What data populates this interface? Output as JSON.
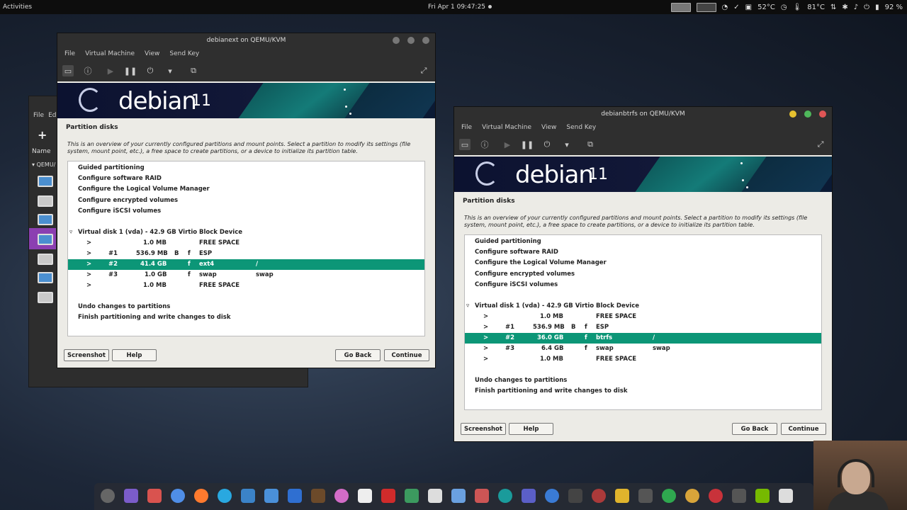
{
  "topbar": {
    "activities": "Activities",
    "clock": "Fri Apr 1  09:47:25",
    "temp1": "52°C",
    "temp2": "81°C",
    "battery": "92 %"
  },
  "background_window": {
    "menu": [
      "File",
      "Ed"
    ],
    "plus": "+",
    "name_header": "Name",
    "group": "QEMU/"
  },
  "vm_left": {
    "title": "debianext on QEMU/KVM",
    "menu": [
      "File",
      "Virtual Machine",
      "View",
      "Send Key"
    ],
    "banner": {
      "logo": "debian",
      "version": "11"
    },
    "page_title": "Partition disks",
    "description": "This is an overview of your currently configured partitions and mount points. Select a partition to modify its settings (file system, mount point, etc.), a free space to create partitions, or a device to initialize its partition table.",
    "options": [
      "Guided partitioning",
      "Configure software RAID",
      "Configure the Logical Volume Manager",
      "Configure encrypted volumes",
      "Configure iSCSI volumes"
    ],
    "disk": "Virtual disk 1 (vda) - 42.9 GB Virtio Block Device",
    "partitions": [
      {
        "arrow": ">",
        "num": "",
        "size": "1.0 MB",
        "boot": "",
        "fmt": "",
        "fs": "FREE SPACE",
        "mount": ""
      },
      {
        "arrow": ">",
        "num": "#1",
        "size": "536.9 MB",
        "boot": "B",
        "fmt": "f",
        "fs": "ESP",
        "mount": ""
      },
      {
        "arrow": ">",
        "num": "#2",
        "size": "41.4 GB",
        "boot": "",
        "fmt": "f",
        "fs": "ext4",
        "mount": "/"
      },
      {
        "arrow": ">",
        "num": "#3",
        "size": "1.0 GB",
        "boot": "",
        "fmt": "f",
        "fs": "swap",
        "mount": "swap"
      },
      {
        "arrow": ">",
        "num": "",
        "size": "1.0 MB",
        "boot": "",
        "fmt": "",
        "fs": "FREE SPACE",
        "mount": ""
      }
    ],
    "actions": [
      "Undo changes to partitions",
      "Finish partitioning and write changes to disk"
    ],
    "buttons": {
      "screenshot": "Screenshot",
      "help": "Help",
      "back": "Go Back",
      "continue": "Continue"
    }
  },
  "vm_right": {
    "title": "debianbtrfs on QEMU/KVM",
    "menu": [
      "File",
      "Virtual Machine",
      "View",
      "Send Key"
    ],
    "banner": {
      "logo": "debian",
      "version": "11"
    },
    "page_title": "Partition disks",
    "description": "This is an overview of your currently configured partitions and mount points. Select a partition to modify its settings (file system, mount point, etc.), a free space to create partitions, or a device to initialize its partition table.",
    "options": [
      "Guided partitioning",
      "Configure software RAID",
      "Configure the Logical Volume Manager",
      "Configure encrypted volumes",
      "Configure iSCSI volumes"
    ],
    "disk": "Virtual disk 1 (vda) - 42.9 GB Virtio Block Device",
    "partitions": [
      {
        "arrow": ">",
        "num": "",
        "size": "1.0 MB",
        "boot": "",
        "fmt": "",
        "fs": "FREE SPACE",
        "mount": ""
      },
      {
        "arrow": ">",
        "num": "#1",
        "size": "536.9 MB",
        "boot": "B",
        "fmt": "f",
        "fs": "ESP",
        "mount": ""
      },
      {
        "arrow": ">",
        "num": "#2",
        "size": "36.0 GB",
        "boot": "",
        "fmt": "f",
        "fs": "btrfs",
        "mount": "/"
      },
      {
        "arrow": ">",
        "num": "#3",
        "size": "6.4 GB",
        "boot": "",
        "fmt": "f",
        "fs": "swap",
        "mount": "swap"
      },
      {
        "arrow": ">",
        "num": "",
        "size": "1.0 MB",
        "boot": "",
        "fmt": "",
        "fs": "FREE SPACE",
        "mount": ""
      }
    ],
    "actions": [
      "Undo changes to partitions",
      "Finish partitioning and write changes to disk"
    ],
    "buttons": {
      "screenshot": "Screenshot",
      "help": "Help",
      "back": "Go Back",
      "continue": "Continue"
    }
  },
  "colors": {
    "selection": "#0c9677",
    "close_red": "#e05555",
    "min_yellow": "#e6c12f",
    "max_green": "#4fb85b"
  }
}
